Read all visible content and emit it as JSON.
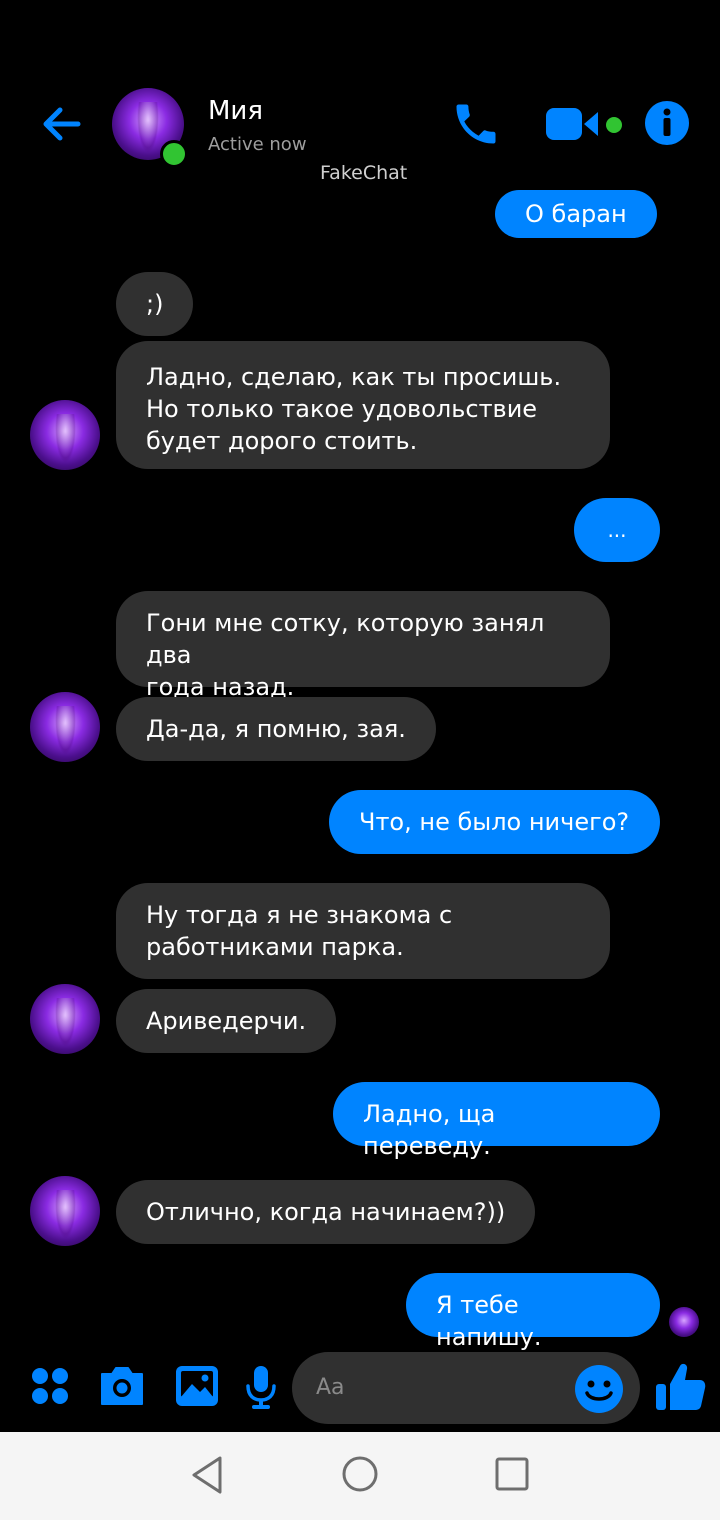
{
  "header": {
    "name": "Мия",
    "status": "Active now",
    "watermark": "FakeChat"
  },
  "messages": [
    {
      "from": "me",
      "text": "О баран"
    },
    {
      "from": "them",
      "text": ";)"
    },
    {
      "from": "them",
      "text": "Ладно, сделаю, как ты просишь.\nНо только такое удовольствие\nбудет дорого стоить."
    },
    {
      "from": "me",
      "text": "..."
    },
    {
      "from": "them",
      "text": "Гони мне сотку, которую занял два\nгода назад."
    },
    {
      "from": "them",
      "text": "Да-да, я помню, зая."
    },
    {
      "from": "me",
      "text": "Что, не было ничего?"
    },
    {
      "from": "them",
      "text": "Ну тогда я не знакома с\nработниками парка."
    },
    {
      "from": "them",
      "text": "Ариведерчи."
    },
    {
      "from": "me",
      "text": "Ладно, ща переведу."
    },
    {
      "from": "them",
      "text": "Отлично, когда начинаем?))"
    },
    {
      "from": "me",
      "text": "Я тебе напишу."
    }
  ],
  "composer": {
    "placeholder": "Aa"
  },
  "colors": {
    "accent": "#0084ff",
    "incoming_bubble": "#303030",
    "online": "#31c432",
    "background": "#000000"
  },
  "icons": [
    "back-arrow-icon",
    "phone-icon",
    "video-camera-icon",
    "info-icon",
    "apps-icon",
    "camera-icon",
    "gallery-icon",
    "mic-icon",
    "emoji-icon",
    "thumbs-up-icon"
  ]
}
